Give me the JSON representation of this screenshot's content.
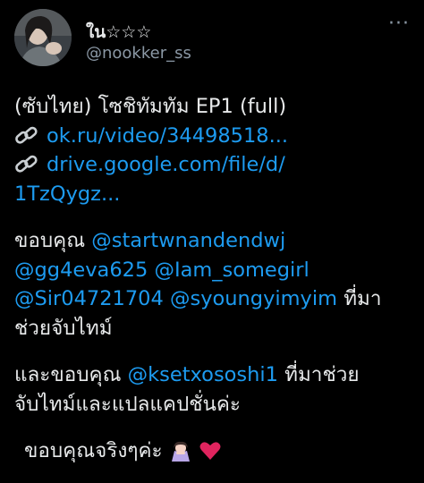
{
  "author": {
    "display_name": "ใน☆☆☆",
    "handle": "@nookker_ss"
  },
  "menu": {
    "more_label": "···"
  },
  "tweet": {
    "title_line": "(ซับไทย) โซชิทัมทัม EP1 (full)",
    "link1": "ok.ru/video/34498518...",
    "link2_part1": "drive.google.com/file/d/",
    "link2_part2": "1TzQygz...",
    "thanks1_prefix": "ขอบคุณ",
    "mentions": {
      "m1": "@startwnandendwj",
      "m2": "@gg4eva625",
      "m3": "@Iam_somegirl",
      "m4": "@Sir04721704",
      "m5": "@syoungyimyim",
      "m6": "@ksetxososhi1"
    },
    "thanks1_suffix_a": "ที่มา",
    "thanks1_suffix_b": "ช่วยจับไทม์",
    "thanks2_prefix": "และขอบคุณ",
    "thanks2_suffix_a": "ที่มาช่วย",
    "thanks2_suffix_b": "จับไทม์และแปลแคปชั่นค่ะ",
    "closing": "ขอบคุณจริงๆค่ะ"
  },
  "icons": {
    "link": "link-chain-icon",
    "bow": "person-bowing-icon",
    "heart": "red-heart-icon"
  },
  "colors": {
    "background": "#000000",
    "text": "#e7e9ea",
    "secondary": "#8b98a5",
    "link": "#1d9bf0",
    "heart": "#e0245e"
  }
}
